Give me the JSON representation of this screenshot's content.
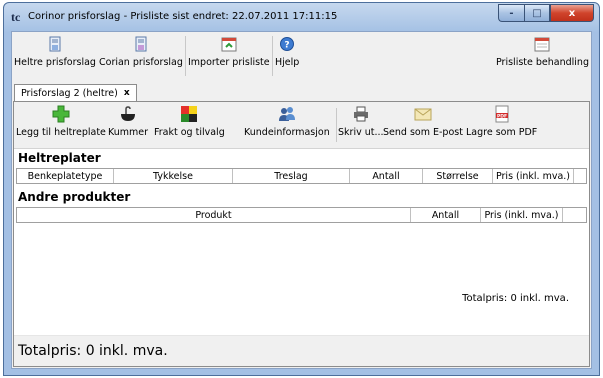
{
  "window": {
    "app_icon": "tc",
    "title": "Corinor prisforslag - Prisliste sist endret: 22.07.2011 17:11:15",
    "controls": {
      "minimize": "-",
      "maximize": "□",
      "close": "x"
    }
  },
  "menubar": {
    "items": [
      {
        "label": "Heltre prisforslag",
        "icon": "document-icon"
      },
      {
        "label": "Corian prisforslag",
        "icon": "document-icon"
      },
      {
        "label": "Importer prisliste",
        "icon": "calendar-import-icon"
      },
      {
        "label": "Hjelp",
        "icon": "help-icon"
      },
      {
        "label": "Prisliste behandling",
        "icon": "calendar-icon"
      }
    ]
  },
  "tab": {
    "label": "Prisforslag 2 (heltre)",
    "close": "x"
  },
  "toolbar": {
    "buttons": [
      {
        "label": "Legg til heltreplate",
        "icon": "plus-icon"
      },
      {
        "label": "Kummer",
        "icon": "sink-icon"
      },
      {
        "label": "Frakt og tilvalg",
        "icon": "palette-icon"
      },
      {
        "label": "Kundeinformasjon",
        "icon": "people-icon"
      },
      {
        "label": "Skriv ut...",
        "icon": "printer-icon"
      },
      {
        "label": "Send som E-post",
        "icon": "envelope-icon"
      },
      {
        "label": "Lagre som PDF",
        "icon": "pdf-icon"
      }
    ]
  },
  "heltreplater": {
    "title": "Heltreplater",
    "columns": [
      "Benkeplatetype",
      "Tykkelse",
      "Treslag",
      "Antall",
      "Størrelse",
      "Pris (inkl. mva.)"
    ]
  },
  "andre": {
    "title": "Andre produkter",
    "columns": [
      "Produkt",
      "Antall",
      "Pris (inkl. mva.)"
    ]
  },
  "totals": {
    "right": "Totalpris:  0  inkl. mva.",
    "footer": "Totalpris:  0  inkl. mva."
  }
}
